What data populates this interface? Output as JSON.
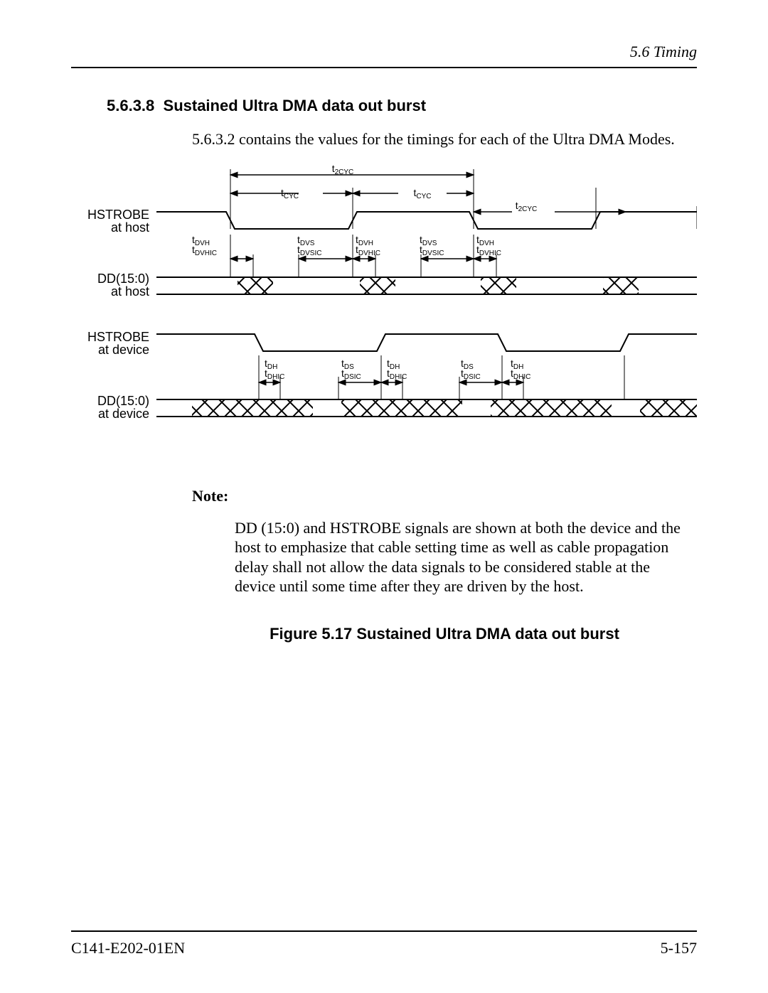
{
  "header": {
    "section": "5.6  Timing"
  },
  "heading": {
    "number": "5.6.3.8",
    "title": "Sustained Ultra DMA data out burst"
  },
  "intro": "5.6.3.2 contains the values for the timings for each of the Ultra DMA Modes.",
  "diagram": {
    "signals": {
      "hstrobe_host": {
        "line1": "HSTROBE",
        "line2": "at host"
      },
      "dd_host": {
        "line1": "DD(15:0)",
        "line2": "at host"
      },
      "hstrobe_dev": {
        "line1": "HSTROBE",
        "line2": "at device"
      },
      "dd_dev": {
        "line1": "DD(15:0)",
        "line2": "at device"
      }
    },
    "timing_labels": {
      "t2cyc": "t2CYC",
      "tcyc": "tCYC",
      "tdvh": "tDVH",
      "tdvhic": "tDVHIC",
      "tdvs": "tDVS",
      "tdvsic": "tDVSIC",
      "tdh": "tDH",
      "tdhic": "tDHIC",
      "tds": "tDS",
      "tdsic": "tDSIC"
    }
  },
  "note": {
    "label": "Note:",
    "body": "DD (15:0) and HSTROBE signals are shown at both the device and the host to emphasize that cable setting time as well as cable propagation delay shall not allow the data signals to be considered stable at the device until some time after they are driven by the host."
  },
  "figure": {
    "caption": "Figure 5.17  Sustained Ultra DMA data out burst"
  },
  "footer": {
    "docnum": "C141-E202-01EN",
    "pagenum": "5-157"
  }
}
